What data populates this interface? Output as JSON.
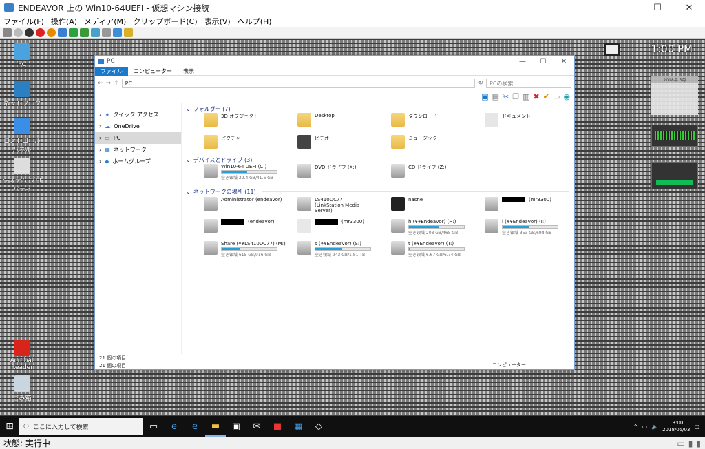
{
  "window": {
    "title": "ENDEAVOR 上の Win10-64UEFI - 仮想マシン接続",
    "minimize": "—",
    "maximize": "☐",
    "close": "✕"
  },
  "menu": [
    "ファイル(F)",
    "操作(A)",
    "メディア(M)",
    "クリップボード(C)",
    "表示(V)",
    "ヘルプ(H)"
  ],
  "status": {
    "label": "状態: 実行中"
  },
  "desktop": {
    "clock": "1:00 PM",
    "icons": [
      {
        "label": "PC",
        "color": "#4aa3df"
      },
      {
        "label": "ネットワーク",
        "color": "#2c7fc0"
      },
      {
        "label": "コントロール パネル",
        "color": "#3a8ee6"
      },
      {
        "label": "システム プロパティ",
        "color": "#dddddd"
      },
      {
        "label": "Acrobat Reader",
        "color": "#d8251c"
      },
      {
        "label": "ごみ箱",
        "color": "#c9d6e0"
      }
    ],
    "calendar": {
      "header": "2018年 5月"
    }
  },
  "explorer": {
    "title": "PC",
    "ribbon_tabs": [
      "ファイル",
      "コンピューター",
      "表示"
    ],
    "address": "PC",
    "search_placeholder": "PCの検索",
    "nav": [
      "クイック アクセス",
      "OneDrive",
      "PC",
      "ネットワーク",
      "ホームグループ"
    ],
    "groups": {
      "folders": "フォルダー (7)",
      "drives": "デバイスとドライブ (3)",
      "network": "ネットワークの場所 (11)"
    },
    "folders": [
      "3D オブジェクト",
      "Desktop",
      "ダウンロード",
      "ドキュメント",
      "ピクチャ",
      "ビデオ",
      "ミュージック"
    ],
    "drives": [
      {
        "name": "Win10-64 UEFI (C:)",
        "space": "空き領域 22.4 GB/41.6 GB",
        "fill": 0.46
      },
      {
        "name": "DVD ドライブ (X:)",
        "space": "",
        "fill": null
      },
      {
        "name": "CD ドライブ (Z:)",
        "space": "",
        "fill": null
      }
    ],
    "network": [
      {
        "name": "Administrator (endeavor)",
        "space": "",
        "fill": null
      },
      {
        "name": "LS410DC77 (LinkStation Media Server)",
        "space": "",
        "fill": null
      },
      {
        "name": "nasne",
        "space": "",
        "fill": null
      },
      {
        "name": "(mr3300)",
        "space": "",
        "fill": null,
        "redacted": true
      },
      {
        "name": "(endeavor)",
        "space": "",
        "fill": null,
        "redacted": true
      },
      {
        "name": "(mr3300)",
        "space": "",
        "fill": null,
        "redacted": true
      },
      {
        "name": "h (¥¥Endeavor) (H:)",
        "space": "空き領域 208 GB/465 GB",
        "fill": 0.55
      },
      {
        "name": "i (¥¥Endeavor) (I:)",
        "space": "空き領域 353 GB/698 GB",
        "fill": 0.49
      },
      {
        "name": "Share (¥¥LS410DC77) (M:)",
        "space": "空き領域 615 GB/916 GB",
        "fill": 0.33
      },
      {
        "name": "s (¥¥Endeavor) (S:)",
        "space": "空き領域 943 GB/1.81 TB",
        "fill": 0.49
      },
      {
        "name": "t (¥¥Endeavor) (T:)",
        "space": "空き領域 6.67 GB/6.74 GB",
        "fill": 0.01
      }
    ],
    "status_count": "21 個の項目",
    "status_count2": "21 個の項目",
    "status_right": "コンピューター"
  },
  "taskbar": {
    "search_placeholder": "ここに入力して検索",
    "time": "13:00",
    "date": "2018/05/03"
  }
}
